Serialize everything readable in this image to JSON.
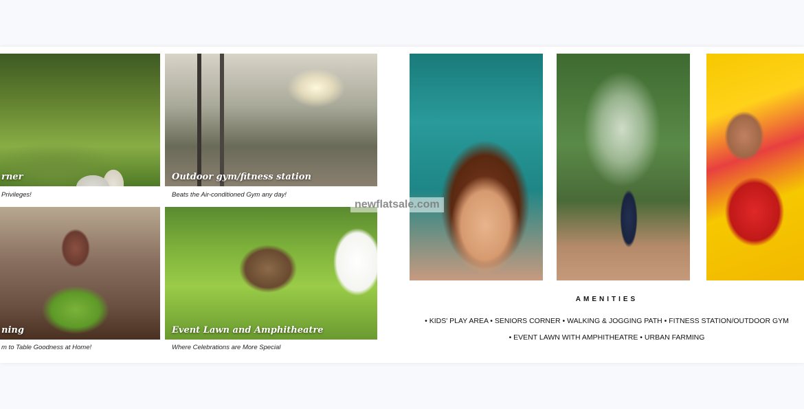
{
  "tiles": [
    {
      "title": "rner",
      "caption": "Privileges!"
    },
    {
      "title": "Outdoor gym/fitness station",
      "caption": "Beats the Air-conditioned Gym any day!"
    },
    {
      "title": "ning",
      "caption": "m to Table Goodness at Home!"
    },
    {
      "title": "Event Lawn and Amphitheatre",
      "caption": "Where Celebrations are More Special"
    }
  ],
  "watermark": "newflatsale.com",
  "amenities": {
    "heading": "AMENITIES",
    "line1": "• KIDS' PLAY AREA • SENIORS CORNER • WALKING & JOGGING PATH • FITNESS STATION/OUTDOOR GYM",
    "line2": "• EVENT LAWN WITH AMPHITHEATRE • URBAN FARMING"
  }
}
